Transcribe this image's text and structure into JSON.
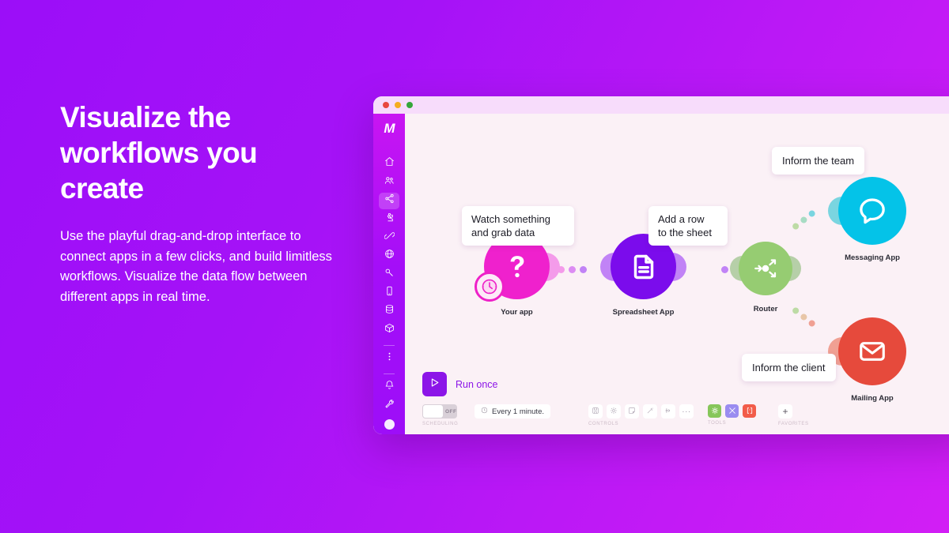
{
  "marketing": {
    "heading": "Visualize the workflows you create",
    "body": "Use the playful drag-and-drop interface to connect apps in a few clicks, and build limitless workflows. Visualize the data flow between different apps in real time."
  },
  "window": {
    "logo": "M",
    "traffic_lights": [
      "close",
      "minimize",
      "maximize"
    ],
    "canvas_bg": "#fbf1f6",
    "titlebar_bg": "#f7dcfb"
  },
  "sidebar": {
    "items": [
      {
        "name": "home-icon",
        "label": "Home"
      },
      {
        "name": "team-icon",
        "label": "Team"
      },
      {
        "name": "scenarios-icon",
        "label": "Scenarios",
        "active": true
      },
      {
        "name": "templates-icon",
        "label": "Templates"
      },
      {
        "name": "connections-icon",
        "label": "Connections"
      },
      {
        "name": "webhooks-icon",
        "label": "Webhooks"
      },
      {
        "name": "keys-icon",
        "label": "Keys"
      },
      {
        "name": "devices-icon",
        "label": "Devices"
      },
      {
        "name": "data-stores-icon",
        "label": "Data stores"
      },
      {
        "name": "data-structures-icon",
        "label": "Data structures"
      },
      {
        "name": "more-icon",
        "label": "More"
      },
      {
        "name": "notifications-icon",
        "label": "Notifications"
      },
      {
        "name": "settings-icon",
        "label": "Settings"
      },
      {
        "name": "avatar",
        "label": "Profile"
      }
    ]
  },
  "flow": {
    "nodes": [
      {
        "id": "your-app",
        "label": "Your app",
        "tooltip": "Watch something\nand grab data",
        "color": "#ef21cd",
        "icon": "question-mark-icon",
        "badge": "clock-icon"
      },
      {
        "id": "spreadsheet-app",
        "label": "Spreadsheet App",
        "tooltip": "Add a row\nto the sheet",
        "color": "#7b0cec",
        "icon": "document-icon"
      },
      {
        "id": "router",
        "label": "Router",
        "tooltip": "",
        "color": "#96cc72",
        "icon": "router-icon"
      },
      {
        "id": "messaging-app",
        "label": "Messaging App",
        "tooltip": "Inform the team",
        "color": "#04c3e8",
        "icon": "chat-bubble-icon"
      },
      {
        "id": "mailing-app",
        "label": "Mailing App",
        "tooltip": "Inform the client",
        "color": "#e64a3c",
        "icon": "envelope-icon"
      }
    ]
  },
  "bottom_bar": {
    "run_label": "Run once",
    "run_icon": "play-icon",
    "scheduling": {
      "group_label": "SCHEDULING",
      "toggle_state": "OFF",
      "interval": "Every 1 minute.",
      "interval_icon": "clock-icon"
    },
    "controls": {
      "group_label": "CONTROLS",
      "buttons": [
        {
          "name": "save-icon",
          "label": "Save"
        },
        {
          "name": "gear-icon",
          "label": "Settings"
        },
        {
          "name": "note-icon",
          "label": "Notes"
        },
        {
          "name": "magic-wand-icon",
          "label": "Auto-align"
        },
        {
          "name": "flow-control-icon",
          "label": "Flow control"
        },
        {
          "name": "more-icon",
          "label": "More"
        }
      ]
    },
    "tools": {
      "group_label": "TOOLS",
      "buttons": [
        {
          "name": "gear-tool-icon",
          "color": "#86c65a"
        },
        {
          "name": "tools-icon",
          "color": "#9a8cf0"
        },
        {
          "name": "brackets-icon",
          "color": "#f25c4a"
        }
      ]
    },
    "favorites": {
      "group_label": "FAVORITES",
      "add_label": "+"
    }
  }
}
